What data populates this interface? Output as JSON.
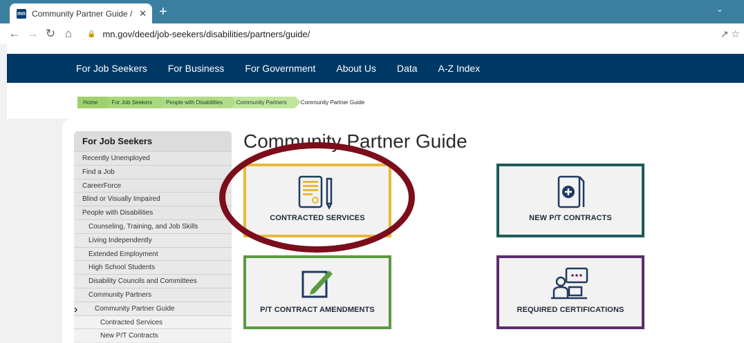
{
  "browser": {
    "tab_title": "Community Partner Guide / Minr",
    "tab_favicon": "mn",
    "tab_close": "✕",
    "new_tab": "+",
    "url": "mn.gov/deed/job-seekers/disabilities/partners/guide/"
  },
  "sitenav": [
    "For Job Seekers",
    "For Business",
    "For Government",
    "About Us",
    "Data",
    "A-Z Index"
  ],
  "breadcrumb": [
    "Home",
    "For Job Seekers",
    "People with Disabilities",
    "Community Partners",
    "Community Partner Guide"
  ],
  "sidebar": {
    "heading": "For Job Seekers",
    "items": [
      {
        "label": "Recently Unemployed"
      },
      {
        "label": "Find a Job"
      },
      {
        "label": "CareerForce"
      },
      {
        "label": "Blind or Visually Impaired"
      },
      {
        "label": "People with Disabilities"
      },
      {
        "label": "Counseling, Training, and Job Skills"
      },
      {
        "label": "Living Independently"
      },
      {
        "label": "Extended Employment"
      },
      {
        "label": "High School Students"
      },
      {
        "label": "Disability Councils and Committees"
      },
      {
        "label": "Community Partners"
      },
      {
        "label": "Community Partner Guide"
      },
      {
        "label": "Contracted Services"
      },
      {
        "label": "New P/T Contracts"
      }
    ],
    "current_marker": "›"
  },
  "page": {
    "title": "Community Partner Guide"
  },
  "cards": {
    "contracted": "CONTRACTED SERVICES",
    "new_pt": "NEW P/T CONTRACTS",
    "amendments": "P/T CONTRACT AMENDMENTS",
    "certifications": "REQUIRED CERTIFICATIONS"
  },
  "colors": {
    "nav_bg": "#003865",
    "card_contracted": "#e7b93a",
    "card_new_pt": "#1e5a5b",
    "card_amend": "#5b9a3f",
    "card_req": "#5c2d6b",
    "highlight": "#7c0d1b"
  }
}
